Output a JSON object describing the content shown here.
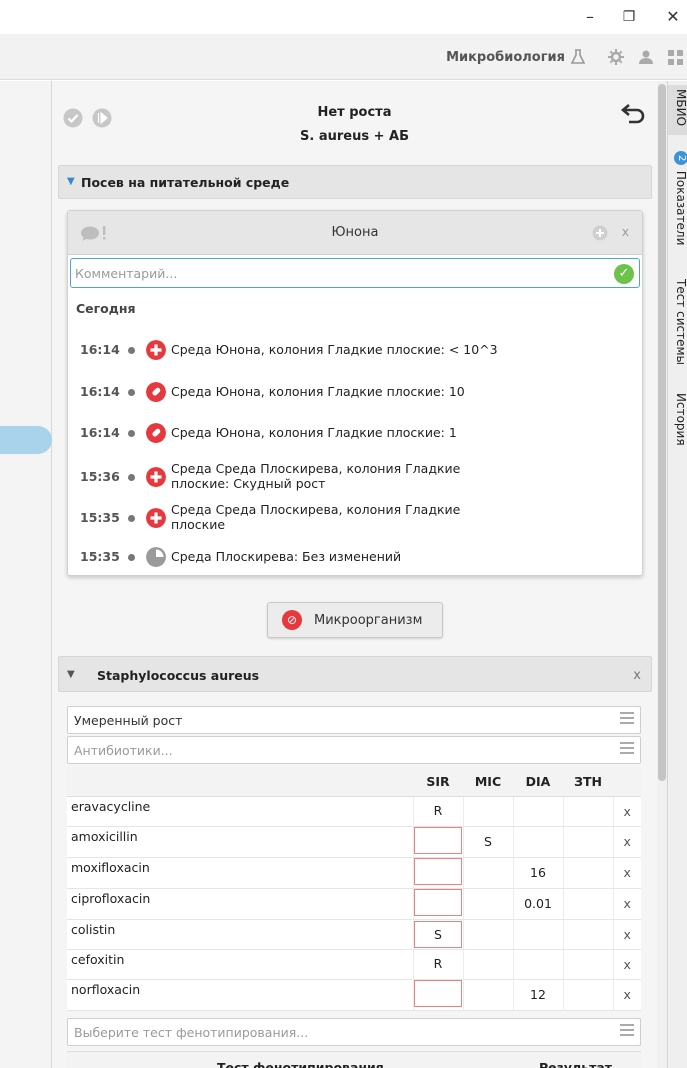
{
  "window": {
    "minimize": "–",
    "restore": "❐",
    "close": "✕"
  },
  "topbar": {
    "title": "Микробиология",
    "icons": [
      "flask-icon",
      "gear-icon",
      "user-icon",
      "grid-icon"
    ]
  },
  "header": {
    "status": "Нет роста",
    "subtitle": "S. aureus + АБ",
    "left_icons": [
      "check-circle-icon",
      "play-circle-icon"
    ],
    "back_icon": "undo-arrow-icon"
  },
  "culture_section": {
    "label": "Посев на питательной среде"
  },
  "comment_card": {
    "medium_name": "Юнона",
    "input_placeholder": "Комментарий...",
    "day_label": "Сегодня",
    "entries": [
      {
        "time": "16:14",
        "icon": "plus-red-icon",
        "text": "Среда Юнона, колония Гладкие плоские: < 10^3"
      },
      {
        "time": "16:14",
        "icon": "pill-red-icon",
        "text": "Среда Юнона, колония Гладкие плоские: 10"
      },
      {
        "time": "16:14",
        "icon": "pill-red-icon",
        "text": "Среда Юнона, колония Гладкие плоские: 1"
      },
      {
        "time": "15:36",
        "icon": "plus-red-icon",
        "text": "Среда Среда Плоскирева, колония Гладкие плоские: Скудный рост"
      },
      {
        "time": "15:35",
        "icon": "plus-red-icon",
        "text": "Среда Среда Плоскирева, колония Гладкие плоские"
      },
      {
        "time": "15:35",
        "icon": "clock-gray-icon",
        "text": "Среда Плоскирева: Без изменений"
      }
    ]
  },
  "microorganism_button": {
    "label": "Микроорганизм"
  },
  "organism_section": {
    "label": "Staphylococcus aureus",
    "close": "x",
    "growth_value": "Умеренный рост",
    "antibiotics_placeholder": "Антибиотики...",
    "columns": [
      "",
      "SIR",
      "MIC",
      "DIA",
      "ЗТН",
      ""
    ],
    "rows": [
      {
        "name": "eravacycline",
        "sir": "R",
        "mic": "",
        "dia": "",
        "ztn": "",
        "x": "x"
      },
      {
        "name": "amoxicillin",
        "sir": "",
        "mic": "S",
        "dia": "",
        "ztn": "",
        "x": "x"
      },
      {
        "name": "moxifloxacin",
        "sir": "",
        "mic": "",
        "dia": "16",
        "ztn": "",
        "x": "x"
      },
      {
        "name": "ciprofloxacin",
        "sir": "",
        "mic": "",
        "dia": "0.01",
        "ztn": "",
        "x": "x"
      },
      {
        "name": "colistin",
        "sir": "S",
        "mic": "",
        "dia": "",
        "ztn": "",
        "x": "x"
      },
      {
        "name": "cefoxitin",
        "sir": "R",
        "mic": "",
        "dia": "",
        "ztn": "",
        "x": "x"
      },
      {
        "name": "norfloxacin",
        "sir": "",
        "mic": "",
        "dia": "12",
        "ztn": "",
        "x": "x"
      }
    ],
    "phenotype_placeholder": "Выберите тест фенотипирования...",
    "phenotype_columns": [
      "Тест фенотипирования",
      "Результат"
    ]
  },
  "right_tabs": [
    {
      "label": "МБИО",
      "active": true,
      "badge": ""
    },
    {
      "label": "Показатели",
      "active": false,
      "badge": "2"
    },
    {
      "label": "Тест системы",
      "active": false,
      "badge": ""
    },
    {
      "label": "История",
      "active": false,
      "badge": ""
    }
  ],
  "colors": {
    "accent_blue": "#3a94d6",
    "red_icon": "#e5393d",
    "ok_green": "#6cc24a",
    "empty_cell_border": "#f08080"
  }
}
